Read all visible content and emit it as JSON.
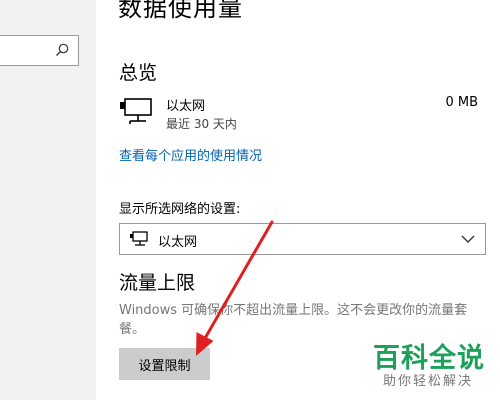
{
  "page": {
    "title": "数据使用量",
    "overview_heading": "总览",
    "limit_heading": "流量上限"
  },
  "usage": {
    "network_name": "以太网",
    "period": "最近 30 天内",
    "amount": "0 MB"
  },
  "links": {
    "per_app": "查看每个应用的使用情况"
  },
  "network_select": {
    "label": "显示所选网络的设置:",
    "selected": "以太网"
  },
  "limit": {
    "description": "Windows 可确保你不超出流量上限。这不会更改你的流量套餐。",
    "button_label": "设置限制"
  },
  "watermark": {
    "main": "百科全说",
    "sub": "助你轻松解决"
  },
  "annotation": {
    "arrow_color": "#e02020"
  }
}
